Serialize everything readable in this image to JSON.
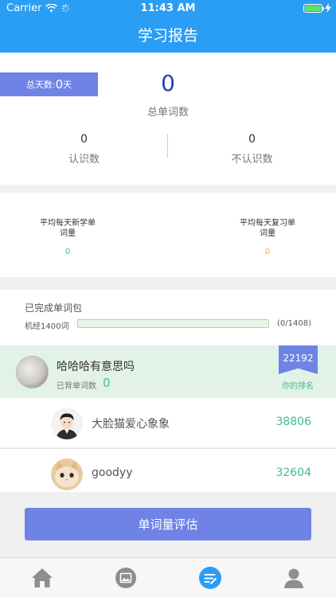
{
  "status_bar": {
    "carrier": "Carrier",
    "time": "11:43 AM"
  },
  "header": {
    "title": "学习报告",
    "background": "#2a9df4"
  },
  "stats": {
    "days_label": "总天数:",
    "days_value": "0",
    "days_unit": "天",
    "total_words": "0",
    "total_words_label": "总单词数",
    "known_count": "0",
    "known_label": "认识数",
    "unknown_count": "0",
    "unknown_label": "不认识数"
  },
  "averages": {
    "new_label": "平均每天新学单词量",
    "new_value": "0",
    "new_color": "#3fbf8a",
    "review_label": "平均每天复习单词量",
    "review_value": "0",
    "review_color": "#f0b429"
  },
  "packages": {
    "title": "已完成单词包",
    "items": [
      {
        "name": "机经1400词",
        "count": "(0/1408)",
        "progress": 0
      }
    ]
  },
  "me": {
    "name": "哈哈哈有意思吗",
    "count_label": "已背单词数",
    "count": "0",
    "rank": "22192",
    "rank_label": "你的排名"
  },
  "leaderboard": [
    {
      "name": "大脸猫爱心象象",
      "count": "38806",
      "avatar_icon": "cartoon-man-avatar"
    },
    {
      "name": "goodyy",
      "count": "32604",
      "avatar_icon": "cat-avatar"
    }
  ],
  "eval_button": {
    "label": "单词量评估"
  },
  "tabbar": {
    "items": [
      {
        "icon": "home-icon"
      },
      {
        "icon": "picture-icon"
      },
      {
        "icon": "report-icon",
        "active": true
      },
      {
        "icon": "profile-icon"
      }
    ]
  },
  "colors": {
    "accent": "#6f83e6",
    "green": "#3fbf8a",
    "header": "#2a9df4"
  }
}
